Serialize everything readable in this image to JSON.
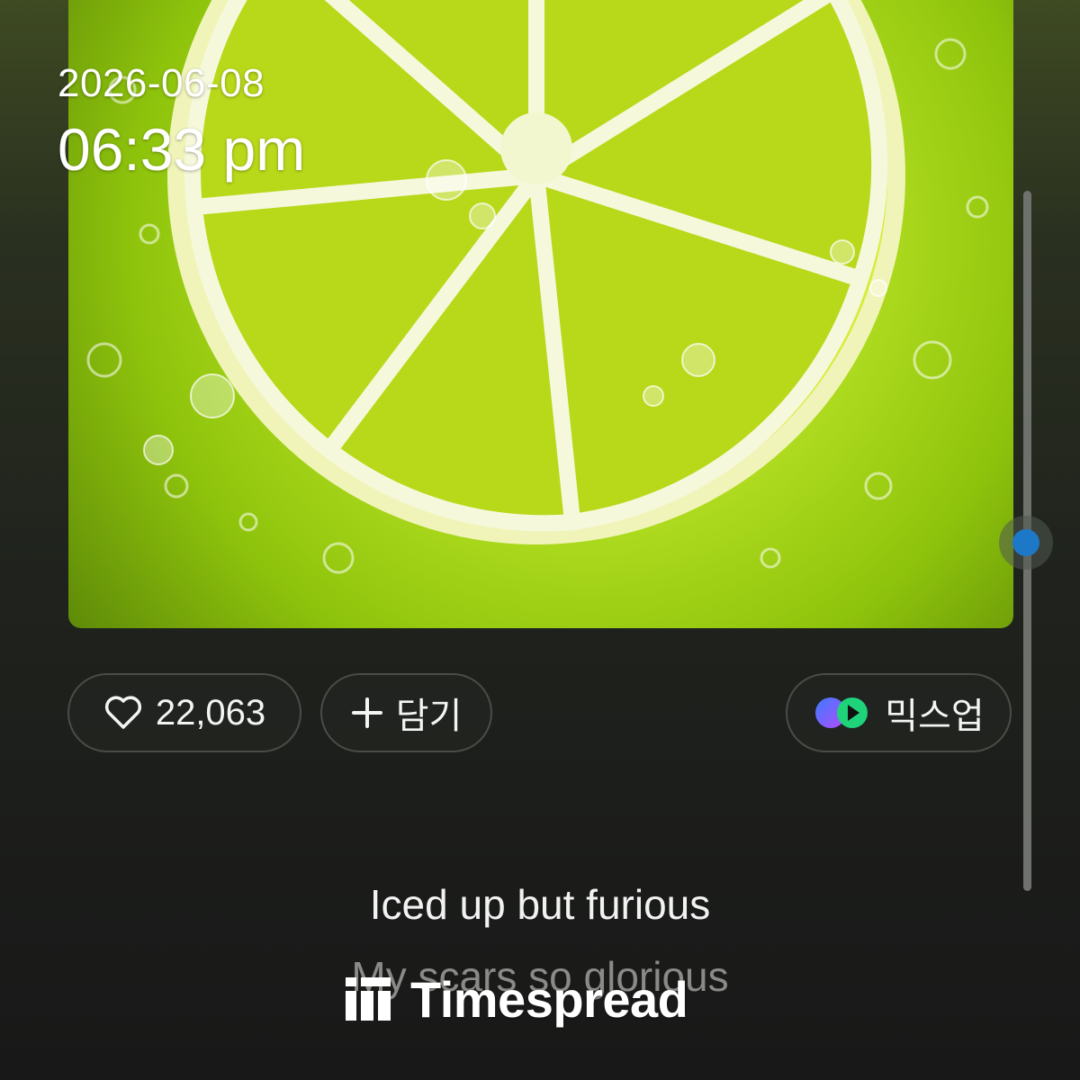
{
  "overlay": {
    "date": "2026-06-08",
    "time": "06:33 pm"
  },
  "actions": {
    "like_count": "22,063",
    "add_label": "담기",
    "mixup_label": "믹스업"
  },
  "lyrics": {
    "current": "Iced up but furious",
    "next": "My scars so glorious"
  },
  "watermark": {
    "brand": "Timespread"
  },
  "colors": {
    "accent": "#1e78c8",
    "pill_border": "#4a4c48",
    "lyric_active": "#f2f2f2",
    "lyric_inactive": "#8a8a86"
  },
  "icons": [
    "heart-icon",
    "plus-icon",
    "mixup-logo-icon",
    "timespread-logo-icon"
  ]
}
